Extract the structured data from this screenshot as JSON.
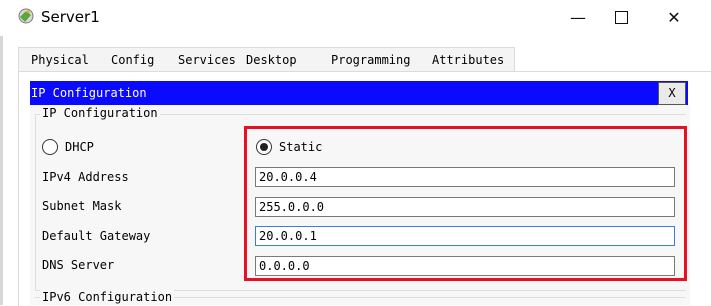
{
  "window": {
    "title": "Server1",
    "minimize_glyph": "—",
    "close_glyph": "✕"
  },
  "tabs": [
    "Physical",
    "Config",
    "Services",
    "Desktop",
    "Programming",
    "Attributes"
  ],
  "active_tab": "Desktop",
  "ip_config": {
    "header_title": "IP Configuration",
    "close_label": "X",
    "group_title": "IP Configuration",
    "dhcp_label": "DHCP",
    "static_label": "Static",
    "selected_mode": "Static",
    "fields": [
      {
        "label": "IPv4 Address",
        "value": "20.0.0.4"
      },
      {
        "label": "Subnet Mask",
        "value": "255.0.0.0"
      },
      {
        "label": "Default Gateway",
        "value": "20.0.0.1"
      },
      {
        "label": "DNS Server",
        "value": "0.0.0.0"
      }
    ],
    "ipv6_title": "IPv6 Configuration"
  },
  "colors": {
    "header_blue": "#0a0aff",
    "highlight_red": "#e81123",
    "active_tab_underline": "#1a2a6c"
  },
  "icons": [
    "server-app-icon",
    "minimize-icon",
    "maximize-icon",
    "close-icon"
  ]
}
